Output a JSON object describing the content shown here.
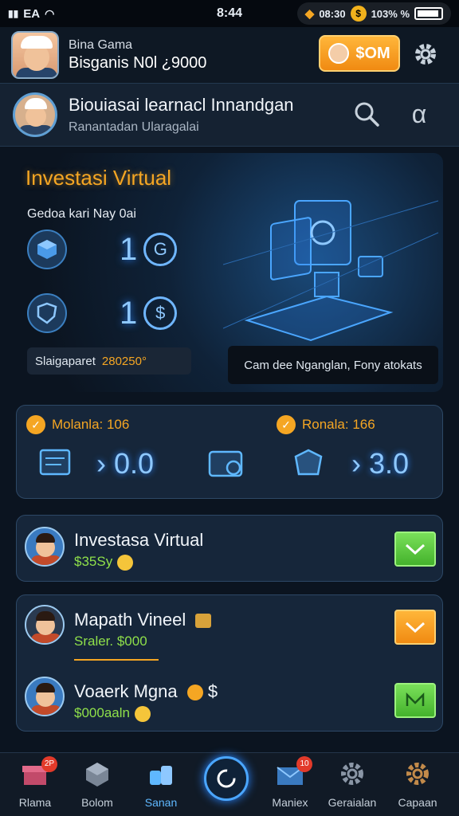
{
  "status_bar": {
    "left_text": "EA",
    "time": "8:44",
    "coins": "08:30",
    "percent": "103% %"
  },
  "header": {
    "name": "Bina Gama",
    "balance": "Bisganis N0l ¿9000",
    "money_button_label": "$OM"
  },
  "profile": {
    "title": "Biouiasai learnacl Innandgan",
    "subtitle": "Ranantadan Ularagalai"
  },
  "hero": {
    "title": "Investasi Virtual",
    "subtitle": "Gedoa kari Nay 0ai",
    "stats": [
      {
        "value": "1",
        "badge": "G"
      },
      {
        "value": "1",
        "badge": "$"
      }
    ],
    "pill_label": "Slaigaparet",
    "pill_value": "280250°",
    "pill2_text": "Cam dee Nganglan, Fony atokats"
  },
  "balances": [
    {
      "label": "Molanla: 106",
      "value": "› 0.0"
    },
    {
      "label": "Ronala: 166",
      "value": "› 3.0"
    }
  ],
  "items": [
    {
      "title": "Investasa Virtual",
      "sub": "$35Sy"
    },
    {
      "title": "Mapath Vineel",
      "sub": "Sraler. $000"
    },
    {
      "title": "Voaerk Mgna",
      "title_suffix": "$",
      "sub": "$000aaln"
    }
  ],
  "nav": [
    {
      "label": "Rlama",
      "badge": "2P"
    },
    {
      "label": "Bolom"
    },
    {
      "label": "Sanan"
    },
    {
      "label": "Maniex",
      "badge": "10"
    },
    {
      "label": "Geraialan"
    },
    {
      "label": "Capaan"
    }
  ],
  "colors": {
    "accent": "#f5a623",
    "blue_glow": "#8ec8ff",
    "green": "#8fe04a",
    "background": "#0b1420"
  }
}
